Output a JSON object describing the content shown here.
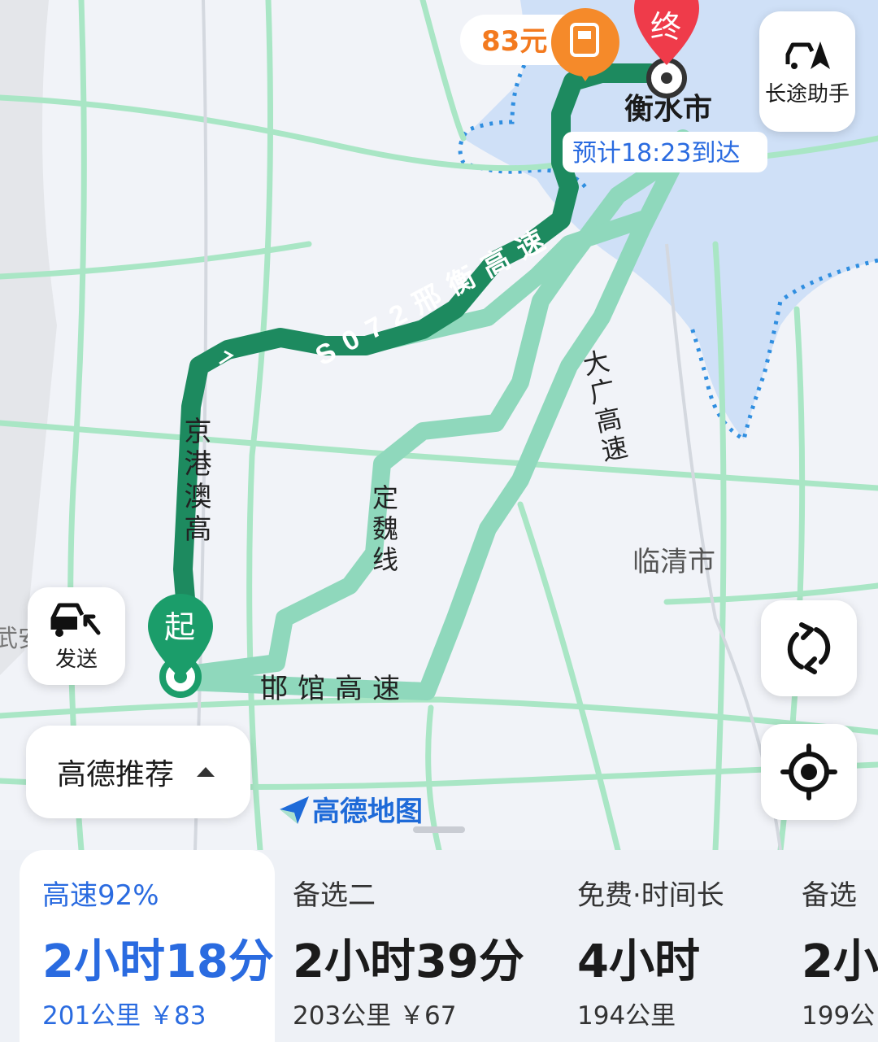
{
  "map": {
    "destination_marker": "终",
    "start_marker": "起",
    "destination_city": "衡水市",
    "other_city": "临清市",
    "left_edge_label": "武安",
    "toll_badge": "83元",
    "eta": "预计18:23到达",
    "road_labels": {
      "s072": "S072邢衡高速",
      "jinggangao": "京港澳高",
      "dingwei": "定魏线",
      "daguang": "大广高速",
      "hanguan": "邯馆高速"
    },
    "logo_text": "高德地图",
    "colors": {
      "selected_route": "#1d8a5f",
      "alt_route": "#8fd8bc",
      "water": "#cfe0f7",
      "boundary": "#2f8ee0",
      "road": "#a9e6c5",
      "dest_marker": "#ef3b4a",
      "start_marker": "#1b9d6a",
      "toll_badge": "#f58a2a"
    }
  },
  "buttons": {
    "long_trip": {
      "label": "长途助手",
      "icon": "car-flag-icon"
    },
    "send": {
      "label": "发送",
      "icon": "car-send-icon"
    },
    "refresh": {
      "icon": "refresh-icon"
    },
    "locate": {
      "icon": "locate-icon"
    }
  },
  "strategy": {
    "label": "高德推荐"
  },
  "routes": [
    {
      "tag": "高速92%",
      "time": "2小时18分",
      "dist": "201公里 ￥83",
      "selected": true
    },
    {
      "tag": "备选二",
      "time": "2小时39分",
      "dist": "203公里 ￥67",
      "selected": false
    },
    {
      "tag": "免费·时间长",
      "time": "4小时",
      "dist": "194公里",
      "selected": false
    },
    {
      "tag": "备选",
      "time": "2小",
      "dist": "199公",
      "selected": false
    }
  ]
}
